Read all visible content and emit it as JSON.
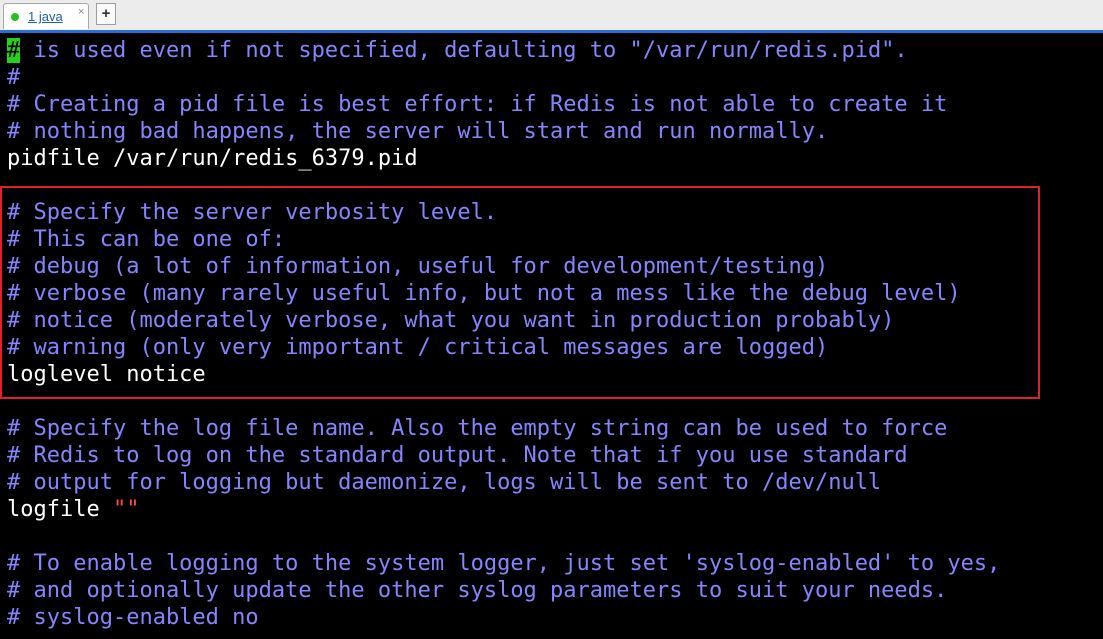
{
  "tabs": [
    {
      "label": "1 java",
      "close": "×",
      "status_color": "#22c21f"
    }
  ],
  "new_tab_label": "+",
  "colors": {
    "comment": "#8585ff",
    "text": "#ffffff",
    "string": "#ff4b4b",
    "cursor": "#22d317",
    "highlight_box": "#e2202a",
    "tab_accent": "#2a6fd6"
  },
  "terminal": {
    "cursor_char": "#",
    "lines": [
      " is used even if not specified, defaulting to \"/var/run/redis.pid\".",
      "#",
      "# Creating a pid file is best effort: if Redis is not able to create it",
      "# nothing bad happens, the server will start and run normally.",
      "pidfile /var/run/redis_6379.pid",
      "",
      "# Specify the server verbosity level.",
      "# This can be one of:",
      "# debug (a lot of information, useful for development/testing)",
      "# verbose (many rarely useful info, but not a mess like the debug level)",
      "# notice (moderately verbose, what you want in production probably)",
      "# warning (only very important / critical messages are logged)",
      "loglevel notice",
      "",
      "# Specify the log file name. Also the empty string can be used to force",
      "# Redis to log on the standard output. Note that if you use standard",
      "# output for logging but daemonize, logs will be sent to /dev/null",
      "logfile ",
      "",
      "# To enable logging to the system logger, just set 'syslog-enabled' to yes,",
      "# and optionally update the other syslog parameters to suit your needs.",
      "# syslog-enabled no"
    ],
    "logfile_value": "\"\""
  }
}
